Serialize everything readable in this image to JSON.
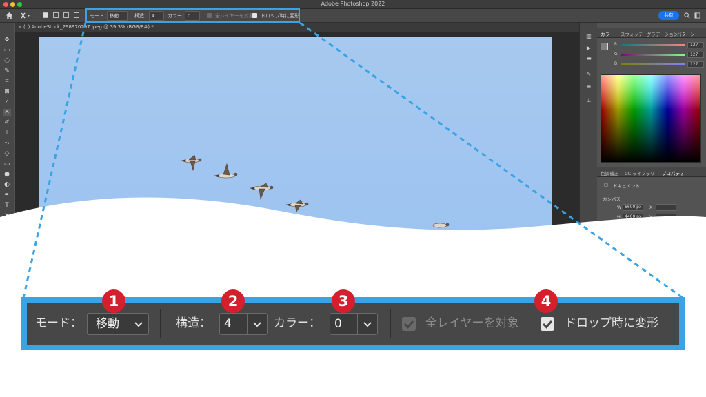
{
  "window": {
    "title": "Adobe Photoshop 2022"
  },
  "options_bar": {
    "mode_label": "モード：",
    "mode_value": "移動",
    "structure_label": "構造：",
    "structure_value": "4",
    "color_label": "カラー：",
    "color_value": "0",
    "all_layers_label": "全レイヤーを対象",
    "all_layers_checked": true,
    "all_layers_enabled": false,
    "transform_on_drop_label": "ドロップ時に変形",
    "transform_on_drop_checked": true,
    "share_label": "共有"
  },
  "document_tab": {
    "label": "(c) AdobeStock_298970297.jpeg @ 39.3% (RGB/8#) *"
  },
  "color_panel": {
    "tabs": [
      "カラー",
      "スウォッチ",
      "グラデーション",
      "パターン"
    ],
    "sliders": [
      {
        "label": "R",
        "value": "127"
      },
      {
        "label": "G",
        "value": "127"
      },
      {
        "label": "B",
        "value": "127"
      }
    ]
  },
  "properties_panel": {
    "tabs": [
      "色調補正",
      "CC ライブラリ",
      "プロパティ"
    ],
    "doc_label": "ドキュメント",
    "canvas_label": "カンバス",
    "width_label": "W",
    "width_value": "6600 px",
    "height_label": "H",
    "height_value": "4400 px",
    "x_label": "X",
    "y_label": "Y"
  },
  "callout": {
    "badges": [
      "1",
      "2",
      "3",
      "4"
    ]
  },
  "colors": {
    "highlight": "#3aa3e3",
    "badge": "#d4202c",
    "share_button": "#1a73e8",
    "sky": "#a0c4ef"
  }
}
